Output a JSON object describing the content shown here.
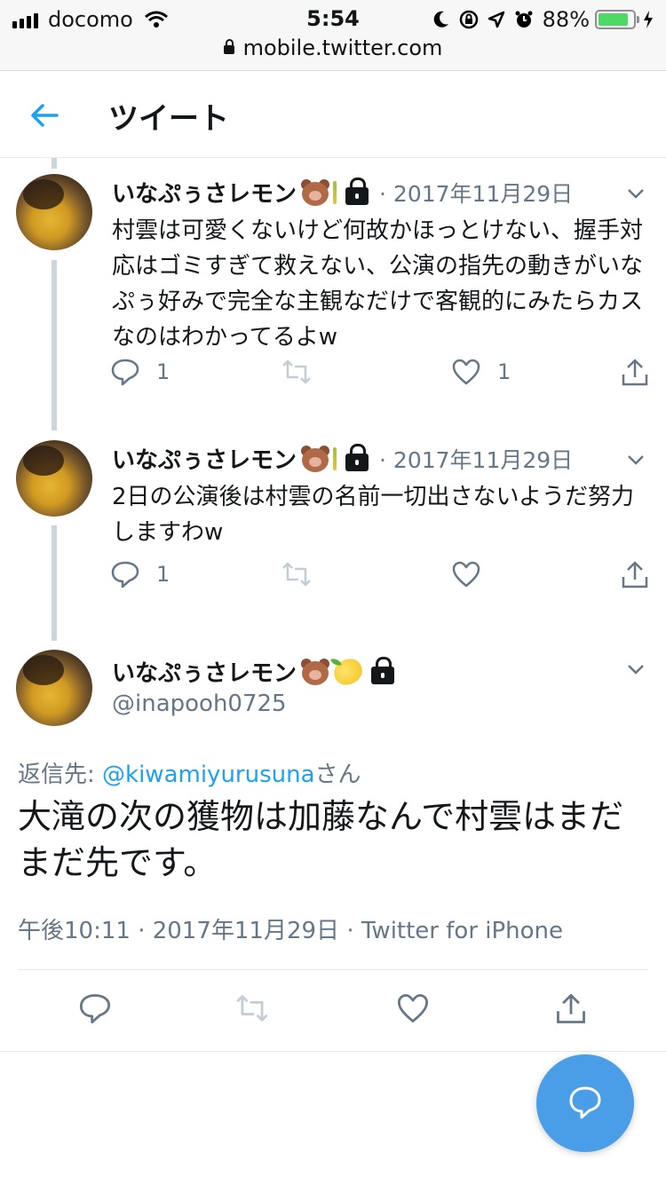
{
  "status_bar": {
    "carrier": "docomo",
    "time": "5:54",
    "battery": "88%",
    "battery_level": 0.88,
    "url": "mobile.twitter.com"
  },
  "header": {
    "title": "ツイート"
  },
  "tweets": [
    {
      "name": "いなぷぅさレモン",
      "date": "2017年11月29日",
      "text": "村雲は可愛くないけど何故かほっとけない、握手対応はゴミすぎて救えない、公演の指先の動きがいなぷぅ好みで完全な主観なだけで客観的にみたらカスなのはわかってるよw",
      "reply_count": "1",
      "like_count": "1"
    },
    {
      "name": "いなぷぅさレモン",
      "date": "2017年11月29日",
      "text": "2日の公演後は村雲の名前一切出さないようだ努力しますわw",
      "reply_count": "1",
      "like_count": ""
    }
  ],
  "main_tweet": {
    "name": "いなぷぅさレモン",
    "handle": "@inapooh0725",
    "reply_prefix": "返信先: ",
    "reply_mention": "@kiwamiyurusuna",
    "reply_suffix": "さん",
    "text": "大滝の次の獲物は加藤なんで村雲はまだまだ先です。",
    "meta": "午後10:11 · 2017年11月29日 · Twitter for iPhone"
  },
  "colors": {
    "accent": "#1da1f2",
    "secondary_text": "#657786",
    "fab": "#4a9ee8"
  }
}
